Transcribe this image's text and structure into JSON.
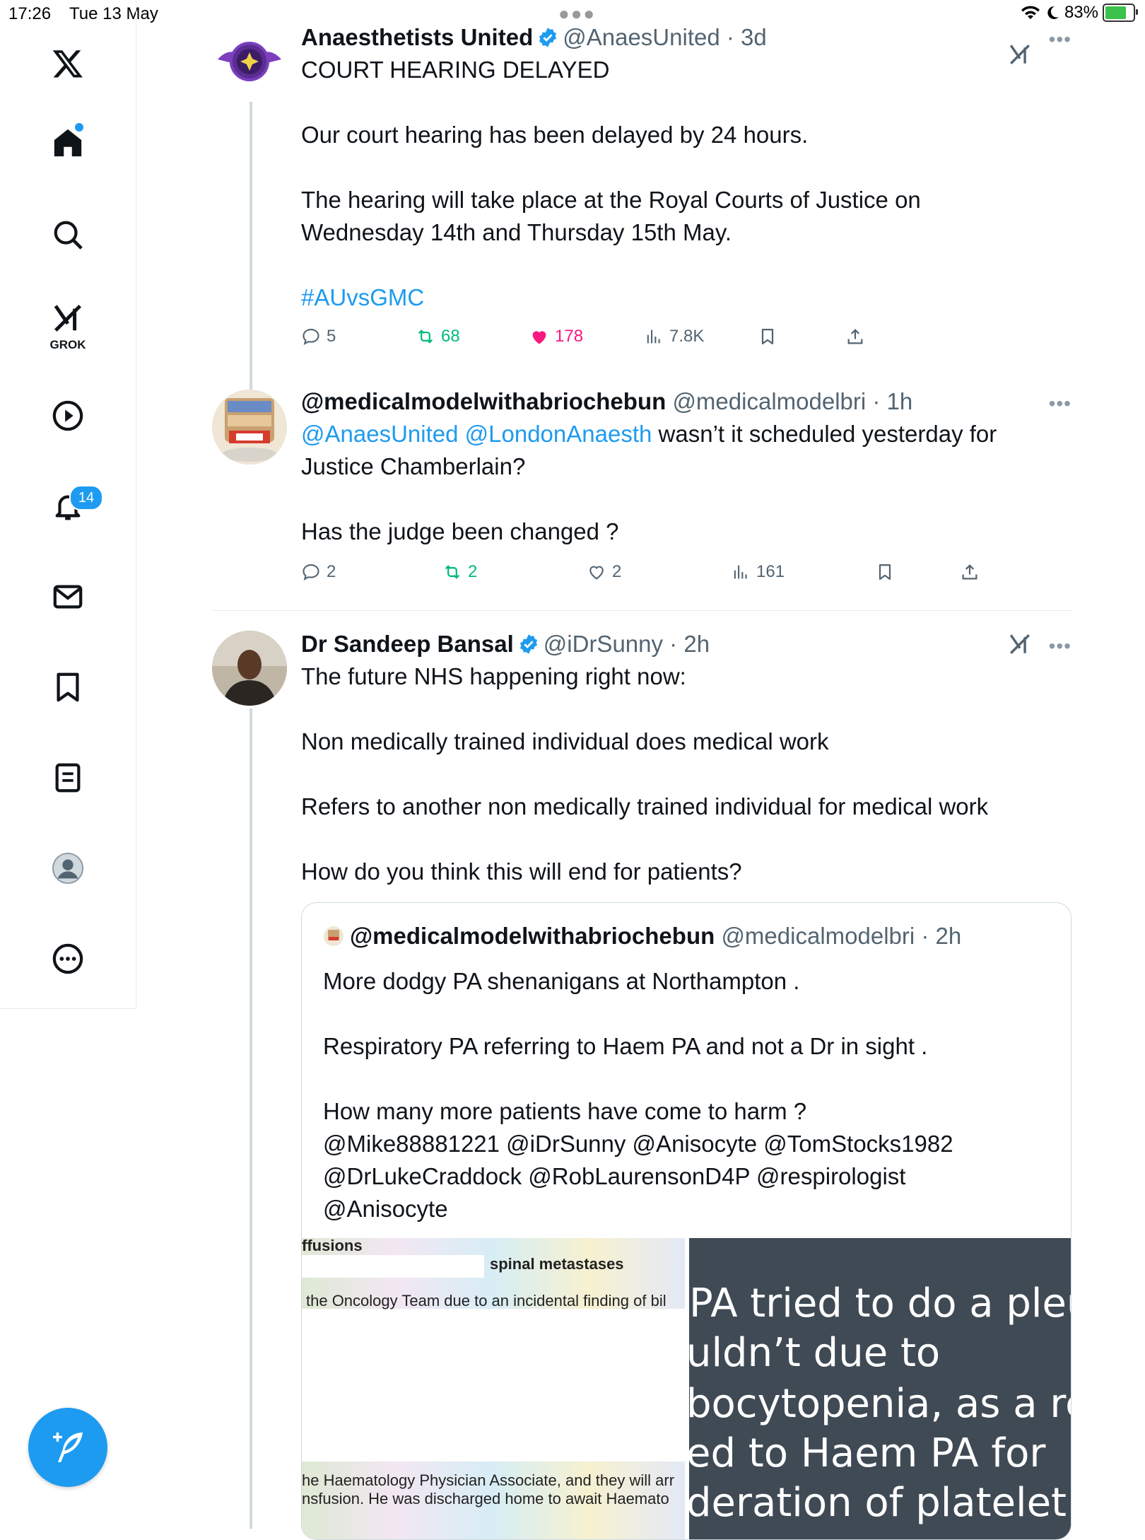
{
  "status_bar": {
    "time": "17:26",
    "date": "Tue 13 May",
    "battery": "83%"
  },
  "sidebar": {
    "grok_label": "GROK",
    "notifications_count": "14"
  },
  "tweets": [
    {
      "name": "Anaesthetists United",
      "handle": "@AnaesUnited",
      "age": "3d",
      "lines": [
        "COURT HEARING DELAYED",
        "",
        "Our court hearing has been delayed by 24 hours.",
        "",
        "The hearing will take place  at the Royal Courts of Justice on",
        "Wednesday 14th and Thursday  15th May.",
        "",
        "#AUvsGMC"
      ],
      "replies": "5",
      "reposts": "68",
      "likes": "178",
      "views": "7.8K"
    },
    {
      "name": "@medicalmodelwithabriochebun",
      "handle": "@medicalmodelbri",
      "age": "1h",
      "mention1": "@AnaesUnited",
      "mention2": "@LondonAnaesth",
      "line1_rest": " wasn’t it scheduled yesterday for",
      "lines": [
        "Justice Chamberlain?",
        "",
        "Has the judge been changed ?"
      ],
      "replies": "2",
      "reposts": "2",
      "likes": "2",
      "views": "161"
    },
    {
      "name": "Dr Sandeep Bansal",
      "handle": "@iDrSunny",
      "age": "2h",
      "lines": [
        "The future NHS happening right now:",
        "",
        "Non medically trained individual does medical work",
        "",
        "Refers to another non medically trained individual for medical work",
        "",
        "How do you think this will end for patients?"
      ],
      "quote": {
        "name": "@medicalmodelwithabriochebun",
        "handle": "@medicalmodelbri",
        "age": "2h",
        "lines": [
          "More dodgy PA shenanigans at Northampton .",
          "",
          "Respiratory PA referring to Haem PA and not a Dr in sight .",
          "",
          "How many more patients have come to harm ?",
          "@Mike88881221 @iDrSunny @Anisocyte @TomStocks1982",
          "@DrLukeCraddock @RobLaurensonD4P @respirologist",
          "@Anisocyte"
        ],
        "image_left": {
          "line1": "ffusions",
          "line2": "spinal metastases",
          "line3": "the Oncology Team due to an incidental finding of bil",
          "line4": "he Haematology Physician Associate, and they will arr",
          "line5": "nsfusion. He was discharged home to await Haemato"
        },
        "image_right": {
          "line1": "PA tried to do a pleura",
          "line2": "uldn’t due to",
          "line3": "bocytopenia, as a res",
          "line4": "ed to Haem PA for",
          "line5": "deration of platelet"
        }
      }
    }
  ],
  "colors": {
    "accent": "#1d9bf0",
    "like": "#f91880",
    "repost": "#00ba7c"
  }
}
